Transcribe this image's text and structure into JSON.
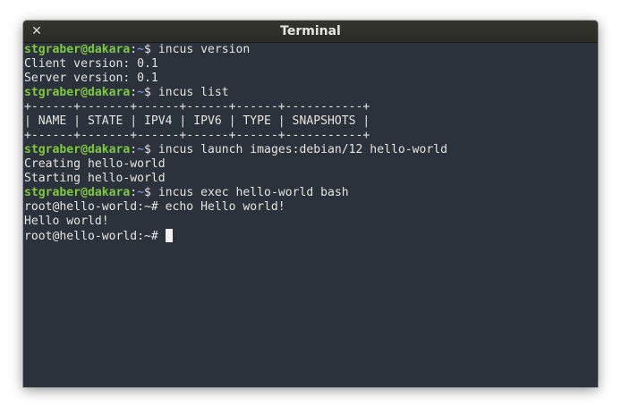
{
  "window": {
    "title": "Terminal",
    "close_glyph": "✕"
  },
  "terminal": {
    "lines": [
      {
        "type": "prompt",
        "user": "stgraber@dakara",
        "sep": ":",
        "path": "~",
        "symbol": "$ ",
        "command": "incus version"
      },
      {
        "type": "output",
        "text": "Client version: 0.1"
      },
      {
        "type": "output",
        "text": "Server version: 0.1"
      },
      {
        "type": "prompt",
        "user": "stgraber@dakara",
        "sep": ":",
        "path": "~",
        "symbol": "$ ",
        "command": "incus list"
      },
      {
        "type": "output",
        "text": "+------+-------+------+------+------+-----------+"
      },
      {
        "type": "output",
        "text": "| NAME | STATE | IPV4 | IPV6 | TYPE | SNAPSHOTS |"
      },
      {
        "type": "output",
        "text": "+------+-------+------+------+------+-----------+"
      },
      {
        "type": "prompt",
        "user": "stgraber@dakara",
        "sep": ":",
        "path": "~",
        "symbol": "$ ",
        "command": "incus launch images:debian/12 hello-world"
      },
      {
        "type": "output",
        "text": "Creating hello-world"
      },
      {
        "type": "output",
        "text": "Starting hello-world"
      },
      {
        "type": "prompt",
        "user": "stgraber@dakara",
        "sep": ":",
        "path": "~",
        "symbol": "$ ",
        "command": "incus exec hello-world bash"
      },
      {
        "type": "output",
        "text": "root@hello-world:~# echo Hello world!"
      },
      {
        "type": "output",
        "text": "Hello world!"
      },
      {
        "type": "current",
        "text": "root@hello-world:~# "
      }
    ]
  },
  "colors": {
    "background": "#2c323b",
    "prompt_user": "#7ec83f",
    "prompt_path": "#6e8ec3",
    "text": "#e4e4e0"
  }
}
